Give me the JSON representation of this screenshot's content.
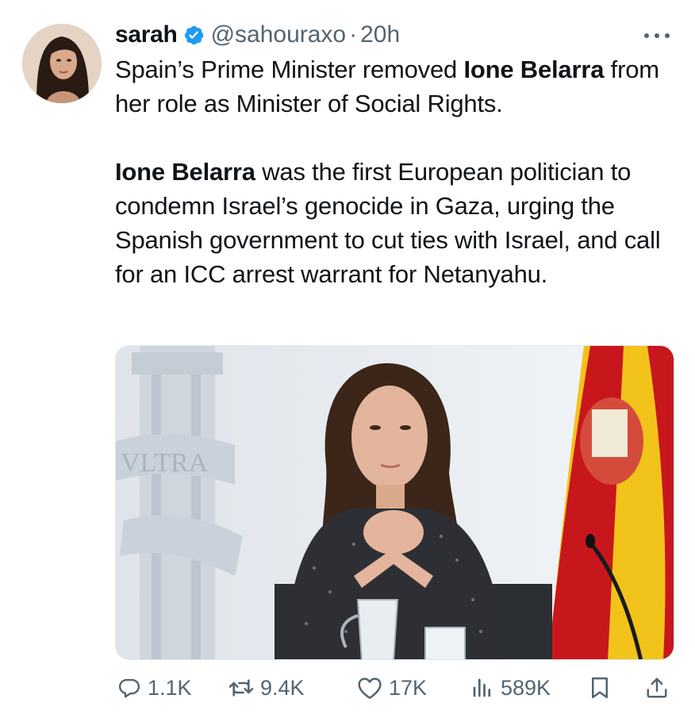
{
  "author": {
    "display_name": "sarah",
    "handle": "@sahouraxo",
    "separator": "·",
    "time": "20h",
    "verified": true
  },
  "tweet": {
    "para1_before": "Spain’s Prime Minister removed ",
    "para1_bold": "Ione Belarra",
    "para1_after": " from her role as Minister of Social Rights.",
    "para2_bold": "Ione Belarra",
    "para2_after": " was the first European politician to condemn Israel’s genocide in Gaza, urging the Spanish government to cut ties with Israel, and call for an ICC arrest warrant for Netanyahu."
  },
  "media": {
    "column_inscription": "VLTRA"
  },
  "actions": {
    "replies": "1.1K",
    "reposts": "9.4K",
    "likes": "17K",
    "views": "589K"
  },
  "colors": {
    "text": "#0f1419",
    "secondary": "#536471",
    "verified": "#1d9bf0"
  },
  "icons": [
    "verified-badge-icon",
    "more-icon",
    "reply-icon",
    "repost-icon",
    "like-icon",
    "views-icon",
    "bookmark-icon",
    "share-icon"
  ]
}
